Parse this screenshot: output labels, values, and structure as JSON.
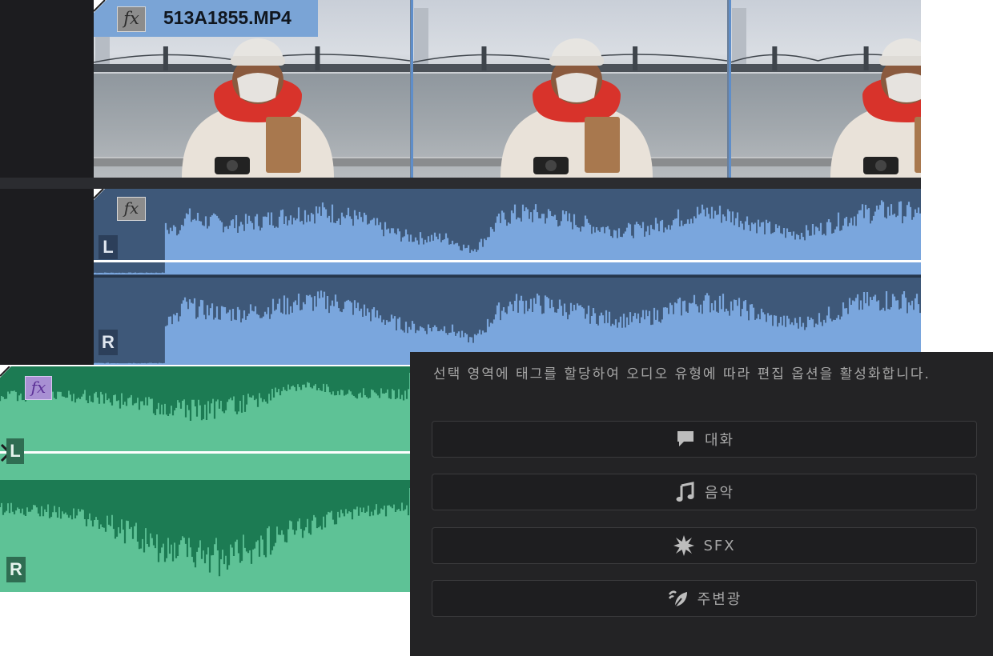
{
  "video_clip": {
    "fx_label": "fx",
    "clip_name": "513A1855.MP4"
  },
  "audio_track_1": {
    "fx_label": "fx",
    "left_channel": "L",
    "right_channel": "R"
  },
  "audio_track_2": {
    "fx_label": "fx",
    "left_channel": "L",
    "right_channel": "R"
  },
  "panel": {
    "description": "선택 영역에 태그를 할당하여 오디오 유형에 따라 편집 옵션을 활성화합니다.",
    "buttons": [
      {
        "label": "대화",
        "icon": "speech-bubble-icon"
      },
      {
        "label": "음악",
        "icon": "music-note-icon"
      },
      {
        "label": "SFX",
        "icon": "starburst-icon"
      },
      {
        "label": "주변광",
        "icon": "leaf-wind-icon"
      }
    ]
  },
  "colors": {
    "video_clip": "#7aa4d6",
    "audio_blue": "#3e5879",
    "waveform_blue": "#7aa6dd",
    "audio_green_bg": "#5ec296",
    "waveform_green": "#1c7b53",
    "panel_bg": "#232325",
    "fx_purple": "#a890d3"
  }
}
